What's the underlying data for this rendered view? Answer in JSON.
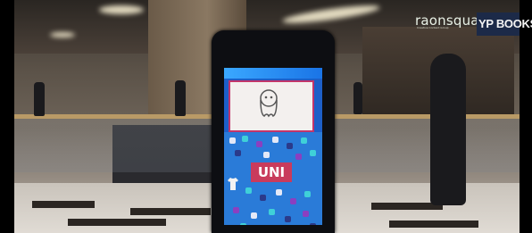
{
  "watermark": {
    "logo_text": "raonsquare",
    "logo_tagline": "Creative Content Group"
  },
  "store_sign": {
    "text": "YP BOOKS 영"
  },
  "kiosk": {
    "banner_text": "UNI"
  },
  "colors": {
    "kiosk_body": "#0d0e12",
    "screen_blue": "#1d5fc8",
    "banner_pink": "#c93b5c",
    "logo_green": "#7cd24a"
  },
  "icons": {
    "doodle": "ghost-doodle-icon",
    "tshirt": "tshirt-icon"
  }
}
